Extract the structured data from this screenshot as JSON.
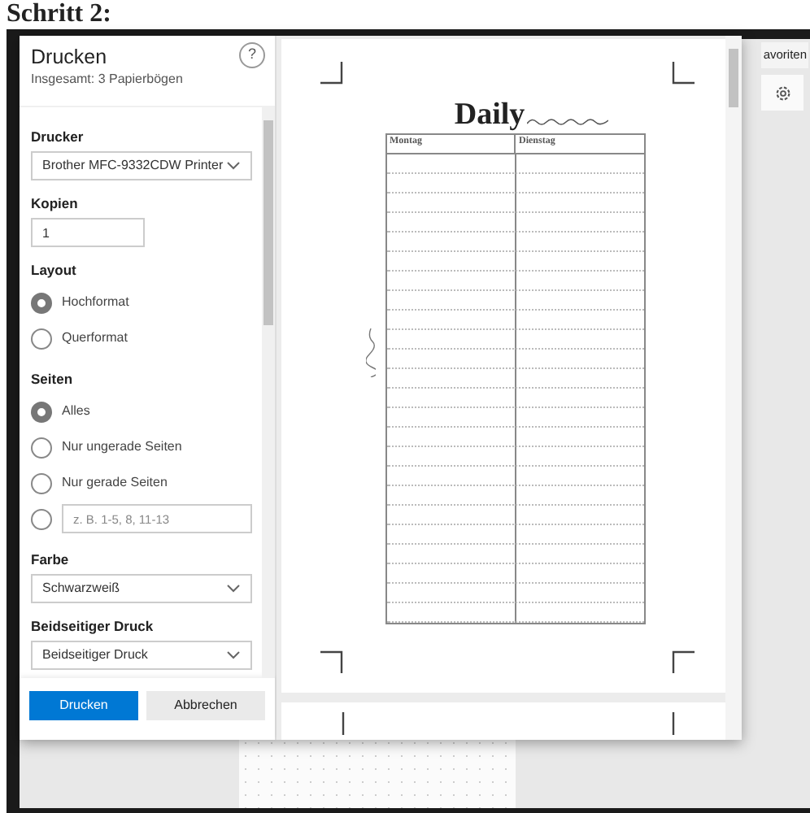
{
  "heading": "Schritt 2:",
  "background": {
    "tab": "avoriten"
  },
  "dialog": {
    "title": "Drucken",
    "subtitle": "Insgesamt: 3 Papierbögen",
    "help": "?",
    "sections": [
      {
        "kind": "select",
        "label": "Drucker",
        "value": "Brother MFC-9332CDW Printer"
      },
      {
        "kind": "input",
        "label": "Kopien",
        "value": "1"
      },
      {
        "kind": "radio",
        "label": "Layout",
        "options": [
          {
            "label": "Hochformat",
            "selected": true
          },
          {
            "label": "Querformat",
            "selected": false
          }
        ]
      },
      {
        "kind": "radio",
        "label": "Seiten",
        "options": [
          {
            "label": "Alles",
            "selected": true
          },
          {
            "label": "Nur ungerade Seiten",
            "selected": false
          },
          {
            "label": "Nur gerade Seiten",
            "selected": false
          },
          {
            "placeholder": "z. B. 1-5, 8, 11-13",
            "selected": false
          }
        ]
      },
      {
        "kind": "select",
        "label": "Farbe",
        "value": "Schwarzweiß"
      },
      {
        "kind": "select",
        "label": "Beidseitiger Druck",
        "value": "Beidseitiger Druck"
      }
    ],
    "buttons": [
      {
        "label": "Drucken",
        "kind": "primary"
      },
      {
        "label": "Abbrechen",
        "kind": "secondary"
      }
    ]
  },
  "preview": {
    "page_title": "Daily",
    "columns": [
      "Montag",
      "Dienstag"
    ]
  }
}
